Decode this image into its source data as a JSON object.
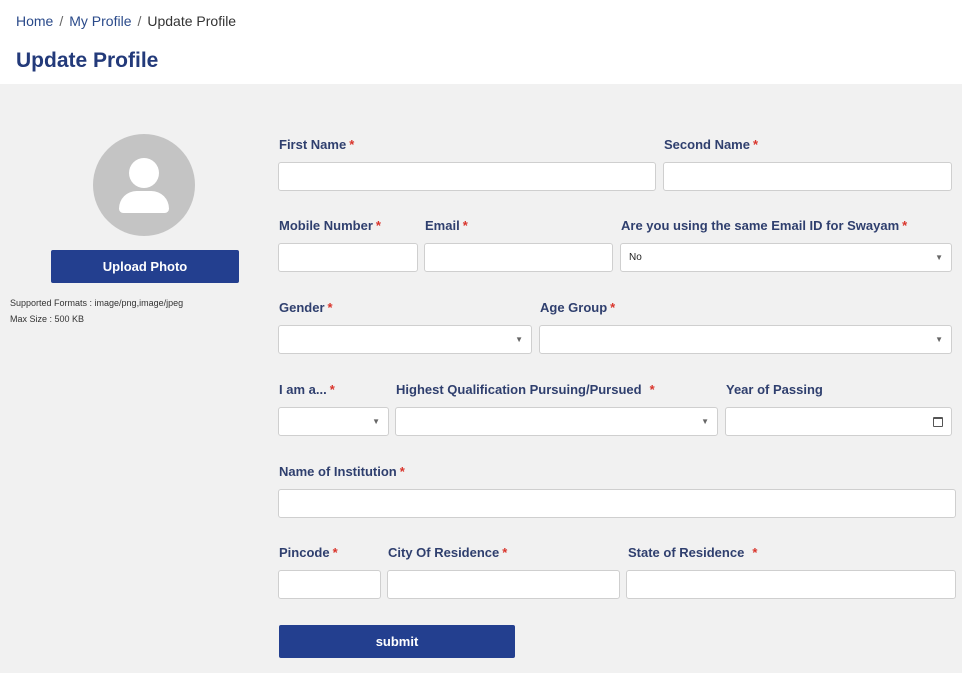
{
  "breadcrumb": {
    "home": "Home",
    "my_profile": "My Profile",
    "current": "Update Profile",
    "separator": "/"
  },
  "page_title": "Update Profile",
  "sidebar": {
    "upload_label": "Upload Photo",
    "formats": "Supported Formats : image/png,image/jpeg",
    "max_size": "Max Size : 500 KB",
    "avatar_icon": "user-silhouette-icon"
  },
  "form": {
    "required_mark": "*",
    "first_name": {
      "label": "First Name",
      "value": ""
    },
    "second_name": {
      "label": "Second Name",
      "value": ""
    },
    "mobile": {
      "label": "Mobile Number",
      "value": ""
    },
    "email": {
      "label": "Email",
      "value": ""
    },
    "swayam": {
      "label": "Are you using the same Email ID for Swayam",
      "value": "No"
    },
    "gender": {
      "label": "Gender",
      "value": ""
    },
    "age_group": {
      "label": "Age Group",
      "value": ""
    },
    "i_am": {
      "label": "I am a...",
      "value": ""
    },
    "qualification": {
      "label": "Highest Qualification Pursuing/Pursued",
      "value": ""
    },
    "year_passing": {
      "label": "Year of Passing",
      "value": ""
    },
    "institution": {
      "label": "Name of Institution",
      "value": ""
    },
    "pincode": {
      "label": "Pincode",
      "value": ""
    },
    "city": {
      "label": "City Of Residence",
      "value": ""
    },
    "state": {
      "label": "State of Residence",
      "value": ""
    },
    "submit_label": "submit"
  },
  "colors": {
    "primary": "#233f8f",
    "title": "#233a7a",
    "required": "#d9342b",
    "panel_bg": "#f1f1f1"
  }
}
